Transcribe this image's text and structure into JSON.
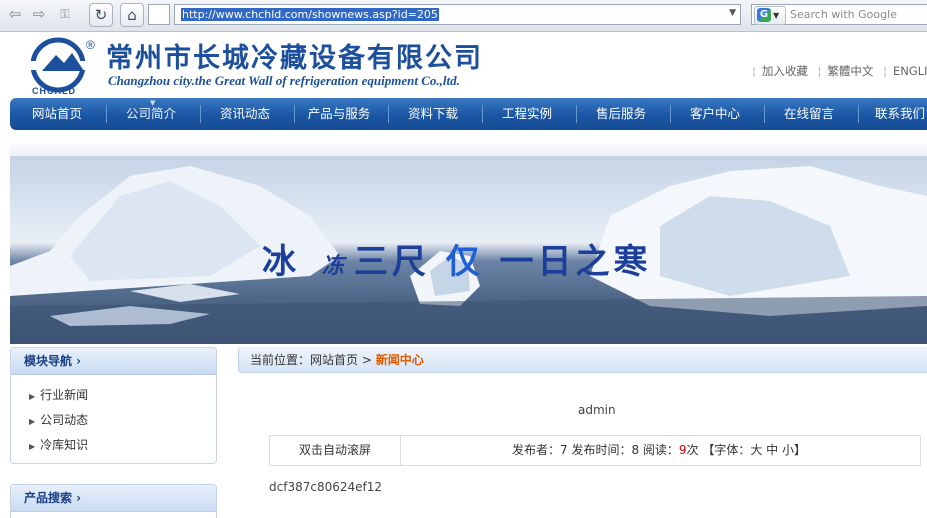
{
  "browser": {
    "url": "http://www.chchld.com/shownews.asp?id=205",
    "search_placeholder": "Search with Google",
    "google_label": "G"
  },
  "header": {
    "logo_text": "CHCHLD",
    "company_name_cn": "常州市长城冷藏设备有限公司",
    "company_name_en": "Changzhou city.the Great Wall of refrigeration equipment Co.,ltd.",
    "links": [
      "加入收藏",
      "繁體中文",
      "ENGLI"
    ]
  },
  "nav": {
    "items": [
      "网站首页",
      "公司简介",
      "资讯动态",
      "产品与服务",
      "资料下载",
      "工程实例",
      "售后服务",
      "客户中心",
      "在线留言",
      "联系我们"
    ],
    "active_index": 1
  },
  "banner": {
    "slogan_part1": "冰",
    "slogan_part2": "冻",
    "slogan_part3": "三尺",
    "slogan_part4": "仅",
    "slogan_part5": "一日之寒"
  },
  "sidebar": {
    "module_nav": {
      "title": "模块导航 ›",
      "items": [
        "行业新闻",
        "公司动态",
        "冷库知识"
      ]
    },
    "product_search": {
      "title": "产品搜索 ›"
    }
  },
  "main": {
    "breadcrumb_prefix": "当前位置：",
    "breadcrumb_home": "网站首页",
    "breadcrumb_sep": " > ",
    "breadcrumb_current": "新闻中心",
    "author": "admin",
    "auto_scroll": "双击自动滚屏",
    "meta_prefix": "发布者：7 发布时间：8 阅读：",
    "read_count": "9",
    "meta_suffix": "次 【字体：大 中 小】",
    "content": "dcf387c80624ef12"
  }
}
